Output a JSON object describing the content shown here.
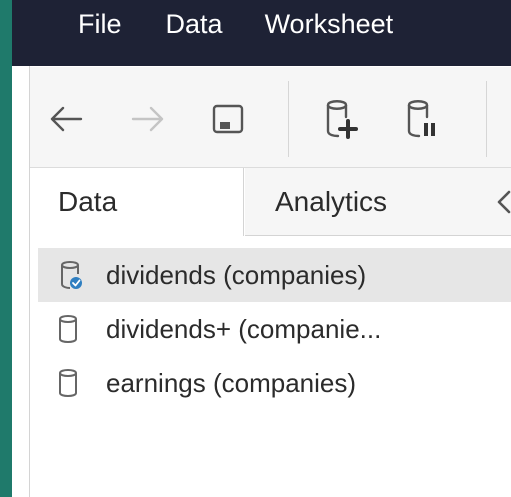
{
  "menubar": {
    "items": [
      {
        "label": "File"
      },
      {
        "label": "Data"
      },
      {
        "label": "Worksheet"
      }
    ]
  },
  "toolbar": {
    "buttons": [
      {
        "icon": "back-arrow-icon",
        "enabled": true
      },
      {
        "icon": "forward-arrow-icon",
        "enabled": false
      },
      {
        "icon": "save-icon",
        "enabled": true
      },
      {
        "icon": "new-data-source-icon",
        "enabled": true
      },
      {
        "icon": "pause-auto-updates-icon",
        "enabled": true
      }
    ]
  },
  "tabs": [
    {
      "label": "Data",
      "active": true
    },
    {
      "label": "Analytics",
      "active": false
    }
  ],
  "data_sources": [
    {
      "label": "dividends (companies)",
      "selected": true
    },
    {
      "label": "dividends+ (companie...",
      "selected": false
    },
    {
      "label": "earnings (companies)",
      "selected": false
    }
  ],
  "colors": {
    "menubar_bg": "#1e2235",
    "accent": "#1f7a6b",
    "selected_row": "#e6e6e6",
    "active_badge": "#2f7fc1"
  }
}
